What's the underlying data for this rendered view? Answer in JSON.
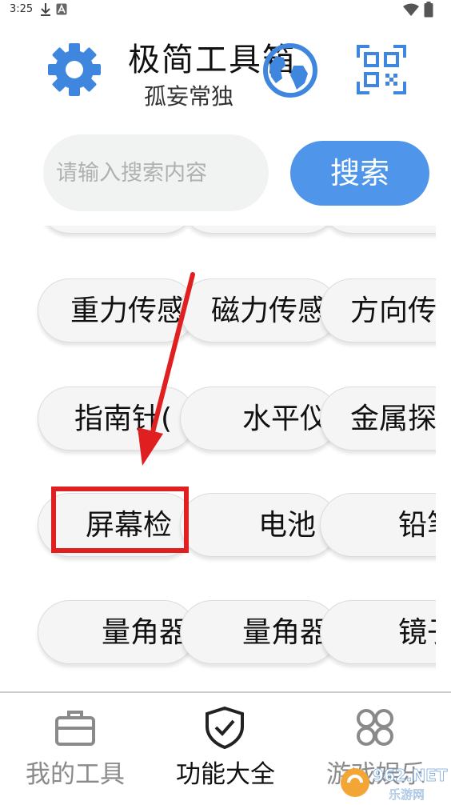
{
  "status_bar": {
    "time": "3:25"
  },
  "header": {
    "title": "极简工具箱",
    "subtitle": "孤妄常独"
  },
  "search": {
    "placeholder": "请输入搜索内容",
    "button_label": "搜索"
  },
  "tools": [
    [
      "重力传感器",
      "磁力传感器",
      "方向传感器"
    ],
    [
      "指南针(",
      "水平仪",
      "金属探测"
    ],
    [
      "屏幕检",
      "电池",
      "铅笔"
    ],
    [
      "量角器",
      "量角器",
      "镜子"
    ]
  ],
  "bottom_nav": {
    "items": [
      {
        "label": "我的工具",
        "active": false
      },
      {
        "label": "功能大全",
        "active": true
      },
      {
        "label": "游戏娱乐",
        "active": false
      }
    ]
  },
  "watermark": {
    "text": "962.NET",
    "subtext": "乐游网"
  },
  "colors": {
    "accent": "#4f95ea",
    "highlight": "#e02020",
    "inactive_nav": "#8a8a8a",
    "active_nav": "#111111"
  }
}
